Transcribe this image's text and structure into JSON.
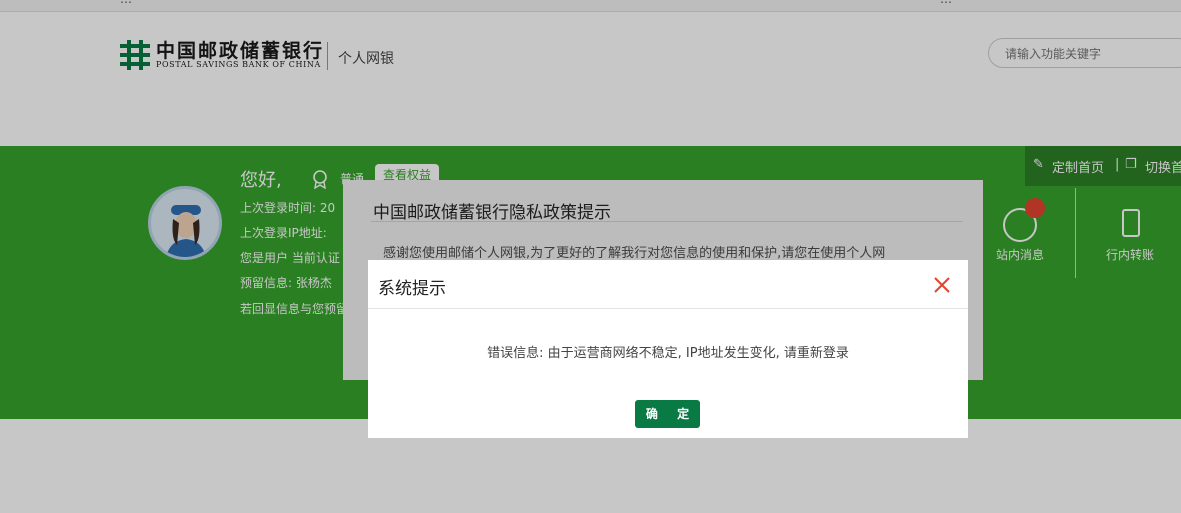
{
  "topbar": {
    "left_text": "…",
    "right_text": "…"
  },
  "header": {
    "logo_cn": "中国邮政储蓄银行",
    "logo_en": "POSTAL SAVINGS BANK OF CHINA",
    "subtitle": "个人网银",
    "search_placeholder": "请输入功能关键字"
  },
  "banner": {
    "greeting": "您好,",
    "level": "普通",
    "rights_button": "查看权益",
    "last_login_time_label": "上次登录时间: 20",
    "last_login_ip_label": "上次登录IP地址:",
    "user_cert_label": "您是用户 当前认证",
    "reserved_info_label": "预留信息: 张杨杰",
    "echo_hint": "若回显信息与您预留",
    "customize_home": "定制首页",
    "switch_label": "切换首",
    "messages_label": "站内消息",
    "transfer_label": "行内转账"
  },
  "privacy_dialog": {
    "title": "中国邮政储蓄银行隐私政策提示",
    "body": "感谢您使用邮储个人网银,为了更好的了解我行对您信息的使用和保护,请您在使用个人网"
  },
  "system_dialog": {
    "title": "系统提示",
    "message": "错误信息: 由于运营商网络不稳定, IP地址发生变化, 请重新登录",
    "ok_button": "确 定"
  },
  "colors": {
    "brand_green": "#35a32b",
    "button_green": "#0a7a45",
    "close_red": "#e5432f"
  }
}
